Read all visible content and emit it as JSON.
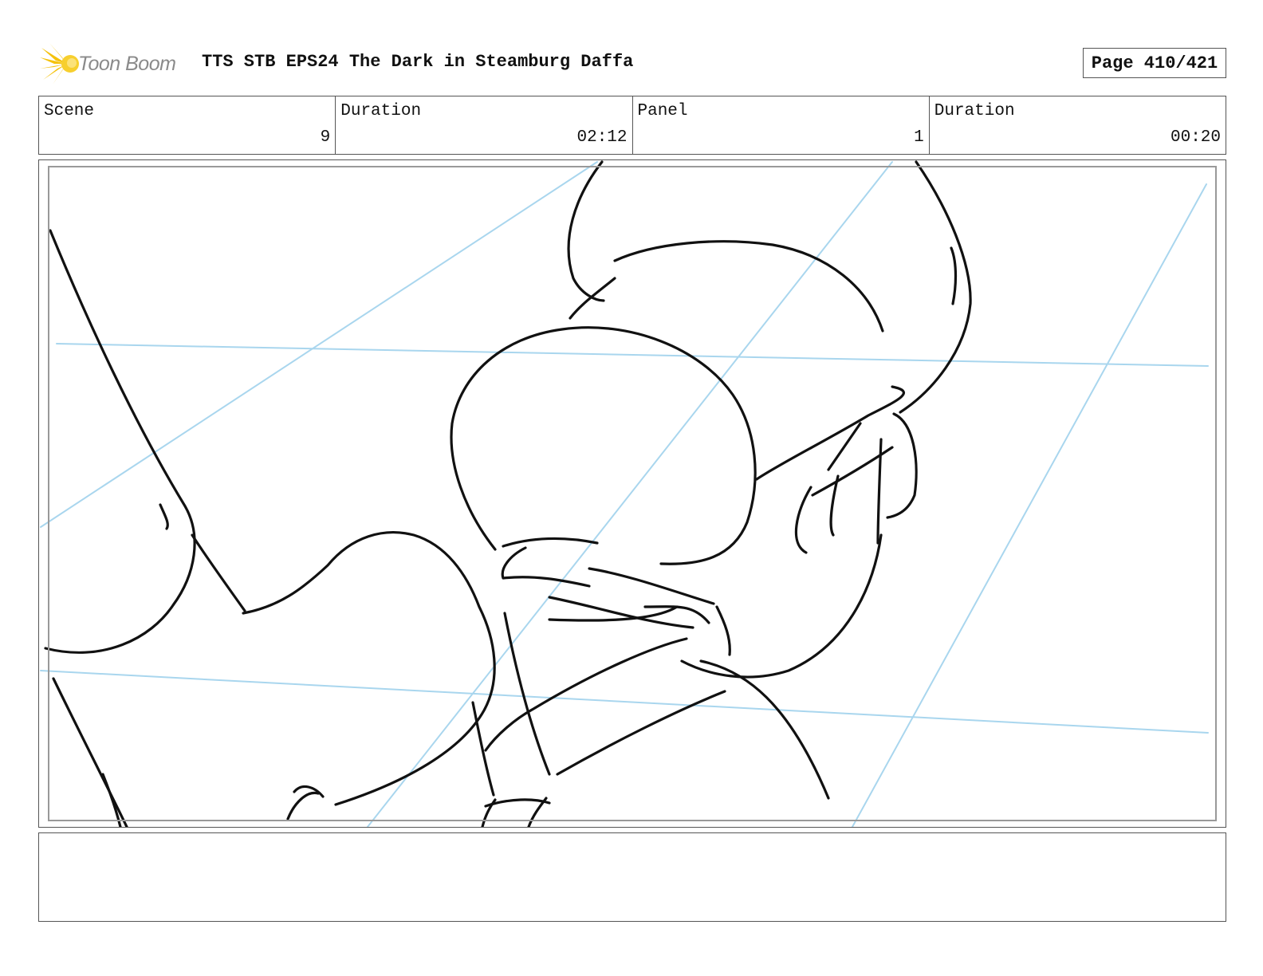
{
  "header": {
    "logo_text": "Toon Boom",
    "title": "TTS STB EPS24 The Dark in Steamburg Daffa",
    "page": "Page 410/421"
  },
  "info": {
    "scene_label": "Scene",
    "scene_value": "9",
    "scene_duration_label": "Duration",
    "scene_duration_value": "02:12",
    "panel_label": "Panel",
    "panel_value": "1",
    "panel_duration_label": "Duration",
    "panel_duration_value": "00:20"
  },
  "notes": {
    "text": ""
  },
  "colors": {
    "logo_accent": "#f5c20b",
    "guide_lines": "#a9d6ee",
    "ink": "#111111"
  }
}
